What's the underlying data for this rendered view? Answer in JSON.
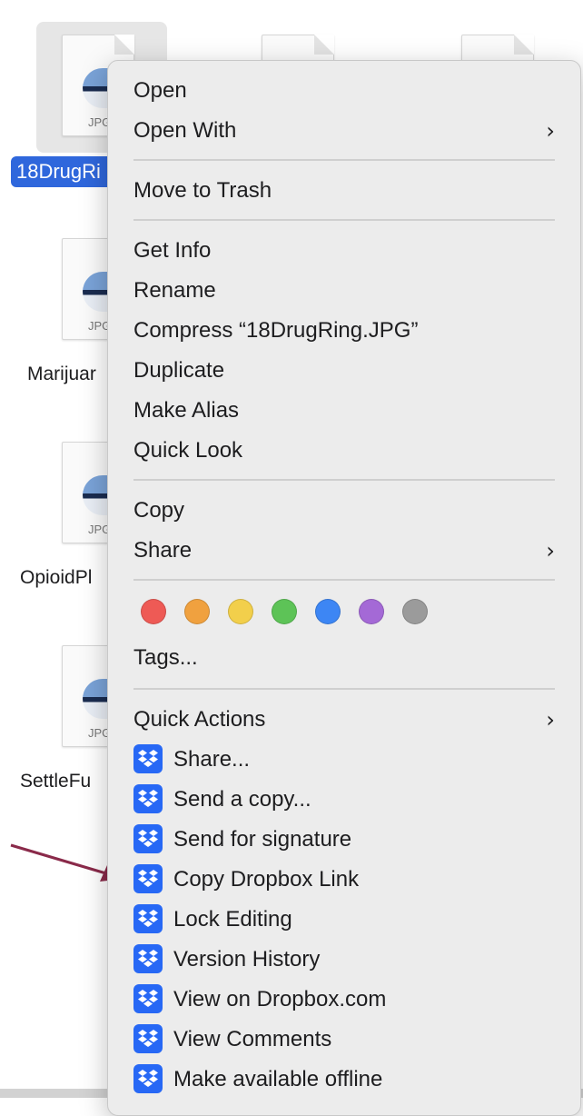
{
  "desktop": {
    "files": [
      {
        "name": "18DrugRi",
        "ext": "JPG",
        "selected": true
      },
      {
        "name": "Marijuar",
        "ext": "JPG"
      },
      {
        "name": "OpioidPl",
        "ext": "JPG"
      },
      {
        "name": "SettleFu",
        "ext": "JPG"
      }
    ]
  },
  "menu": {
    "group1": {
      "open": "Open",
      "open_with": "Open With"
    },
    "group2": {
      "move_to_trash": "Move to Trash"
    },
    "group3": {
      "get_info": "Get Info",
      "rename": "Rename",
      "compress": "Compress “18DrugRing.JPG”",
      "duplicate": "Duplicate",
      "make_alias": "Make Alias",
      "quick_look": "Quick Look"
    },
    "group4": {
      "copy": "Copy",
      "share": "Share"
    },
    "tags": {
      "label": "Tags...",
      "colors": [
        {
          "name": "red",
          "hex": "#ee5a55"
        },
        {
          "name": "orange",
          "hex": "#f0a13f"
        },
        {
          "name": "yellow",
          "hex": "#f2cf4b"
        },
        {
          "name": "green",
          "hex": "#5dc357"
        },
        {
          "name": "blue",
          "hex": "#3d86f4"
        },
        {
          "name": "purple",
          "hex": "#a469d6"
        },
        {
          "name": "gray",
          "hex": "#9b9b9b"
        }
      ]
    },
    "quick_actions": {
      "label": "Quick Actions",
      "items": [
        "Share...",
        "Send a copy...",
        "Send for signature",
        "Copy Dropbox Link",
        "Lock Editing",
        "Version History",
        "View on Dropbox.com",
        "View Comments",
        "Make available offline"
      ],
      "icon": "dropbox-icon"
    },
    "submenu_icon": "chevron-right-icon"
  },
  "annotation": {
    "icon": "arrow-icon",
    "color": "#8a2a4a"
  }
}
